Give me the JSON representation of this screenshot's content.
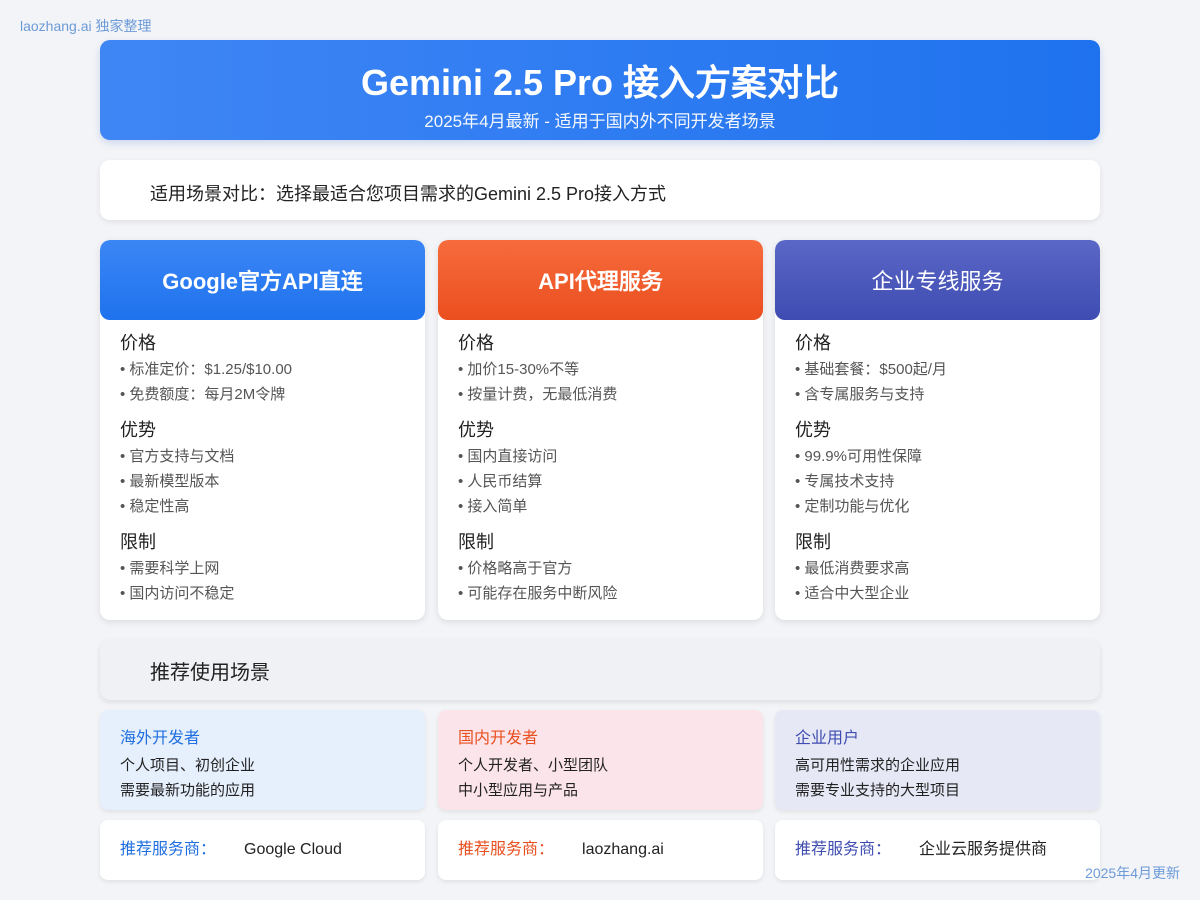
{
  "watermark": {
    "top": "laozhang.ai 独家整理",
    "bottom": "2025年4月更新"
  },
  "header": {
    "title": "Gemini 2.5 Pro 接入方案对比",
    "subtitle": "2025年4月最新 - 适用于国内外不同开发者场景"
  },
  "scenario": {
    "text": "适用场景对比：选择最适合您项目需求的Gemini 2.5 Pro接入方式"
  },
  "colors": {
    "blue": "#1f72ee",
    "orange": "#ea4f1f",
    "indigo": "#3f4cb1"
  },
  "cards": [
    {
      "title": "Google官方API直连",
      "price_title": "价格",
      "price": [
        "标准定价：$1.25/$10.00",
        "免费额度：每月2M令牌"
      ],
      "pros_title": "优势",
      "pros": [
        "官方支持与文档",
        "最新模型版本",
        "稳定性高"
      ],
      "cons_title": "限制",
      "cons": [
        "需要科学上网",
        "国内访问不稳定"
      ]
    },
    {
      "title": "API代理服务",
      "price_title": "价格",
      "price": [
        "加价15-30%不等",
        "按量计费，无最低消费"
      ],
      "pros_title": "优势",
      "pros": [
        "国内直接访问",
        "人民币结算",
        "接入简单"
      ],
      "cons_title": "限制",
      "cons": [
        "价格略高于官方",
        "可能存在服务中断风险"
      ]
    },
    {
      "title": "企业专线服务",
      "price_title": "价格",
      "price": [
        "基础套餐：$500起/月",
        "含专属服务与支持"
      ],
      "pros_title": "优势",
      "pros": [
        "99.9%可用性保障",
        "专属技术支持",
        "定制功能与优化"
      ],
      "cons_title": "限制",
      "cons": [
        "最低消费要求高",
        "适合中大型企业"
      ]
    }
  ],
  "recommend": {
    "title": "推荐使用场景"
  },
  "users": [
    {
      "title": "海外开发者",
      "lines": [
        "个人项目、初创企业",
        "需要最新功能的应用"
      ]
    },
    {
      "title": "国内开发者",
      "lines": [
        "个人开发者、小型团队",
        "中小型应用与产品"
      ]
    },
    {
      "title": "企业用户",
      "lines": [
        "高可用性需求的企业应用",
        "需要专业支持的大型项目"
      ]
    }
  ],
  "providers": [
    {
      "label": "推荐服务商：",
      "name": "Google Cloud"
    },
    {
      "label": "推荐服务商：",
      "name": "laozhang.ai"
    },
    {
      "label": "推荐服务商：",
      "name": "企业云服务提供商"
    }
  ]
}
